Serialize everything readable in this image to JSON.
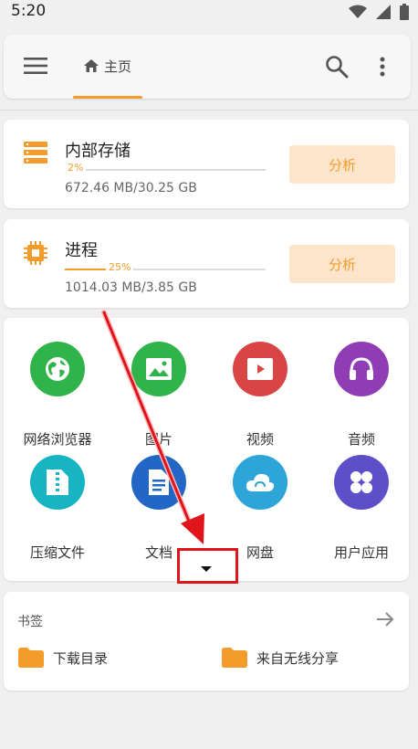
{
  "status_bar": {
    "time": "5:20"
  },
  "toolbar": {
    "home_tab_label": "主页"
  },
  "storage": {
    "title": "内部存储",
    "percent_label": "2%",
    "percent_value": 2,
    "usage": "672.46 MB/30.25 GB",
    "analyze_label": "分析"
  },
  "process": {
    "title": "进程",
    "percent_label": "25%",
    "percent_value": 25,
    "usage": "1014.03 MB/3.85 GB",
    "analyze_label": "分析"
  },
  "apps": [
    {
      "label": "网络浏览器",
      "icon": "globe-icon",
      "color": "#2fb34a"
    },
    {
      "label": "图片",
      "icon": "image-icon",
      "color": "#2fb34a"
    },
    {
      "label": "视频",
      "icon": "video-icon",
      "color": "#d94444"
    },
    {
      "label": "音频",
      "icon": "headphones-icon",
      "color": "#8e3db5"
    },
    {
      "label": "压缩文件",
      "icon": "zip-icon",
      "color": "#18b4c4"
    },
    {
      "label": "文档",
      "icon": "document-icon",
      "color": "#2367c6"
    },
    {
      "label": "网盘",
      "icon": "cloud-icon",
      "color": "#2ea5d8"
    },
    {
      "label": "用户应用",
      "icon": "apps-icon",
      "color": "#5d4fc8"
    }
  ],
  "bookmarks": {
    "title": "书签",
    "items": [
      {
        "label": "下载目录"
      },
      {
        "label": "来自无线分享"
      }
    ]
  },
  "colors": {
    "accent": "#f39c2b",
    "annotation": "#e0141b"
  }
}
